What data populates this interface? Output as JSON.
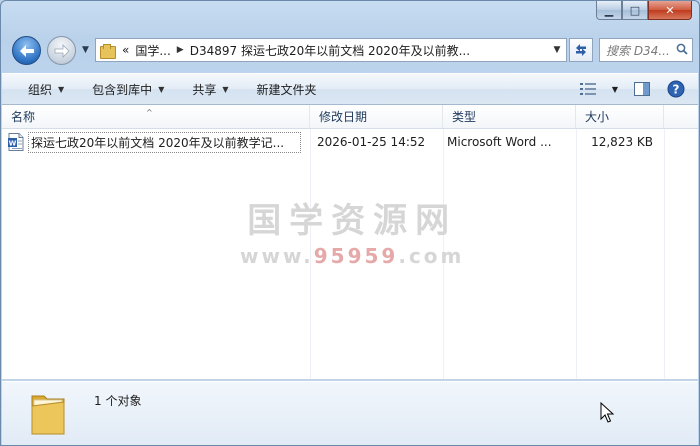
{
  "window": {
    "caption": {
      "minimize": "▁",
      "maximize": "□",
      "close": "✕"
    }
  },
  "nav": {
    "back_icon": "arrow-left-icon",
    "forward_icon": "arrow-right-icon",
    "address": {
      "overflow": "«",
      "crumb_parent": "国学...",
      "crumb_current": "D34897 探运七政20年以前文档 2020年及以前教..."
    },
    "search_placeholder": "搜索 D34..."
  },
  "commands": {
    "organize": "组织",
    "include_in_library": "包含到库中",
    "share": "共享",
    "new_folder": "新建文件夹"
  },
  "columns": {
    "name": "名称",
    "date_modified": "修改日期",
    "type": "类型",
    "size": "大小"
  },
  "files": [
    {
      "name": "探运七政20年以前文档 2020年及以前教学记...",
      "date_modified": "2026-01-25 14:52",
      "type": "Microsoft Word ...",
      "size": "12,823 KB"
    }
  ],
  "watermark": {
    "title": "国学资源网",
    "url_prefix": "www.",
    "url_number": "95959",
    "url_suffix": ".com"
  },
  "status": {
    "item_count": "1 个对象"
  },
  "colors": {
    "accent": "#2a6fc0",
    "folder": "#e7c35b",
    "close_button": "#cf5b40"
  }
}
